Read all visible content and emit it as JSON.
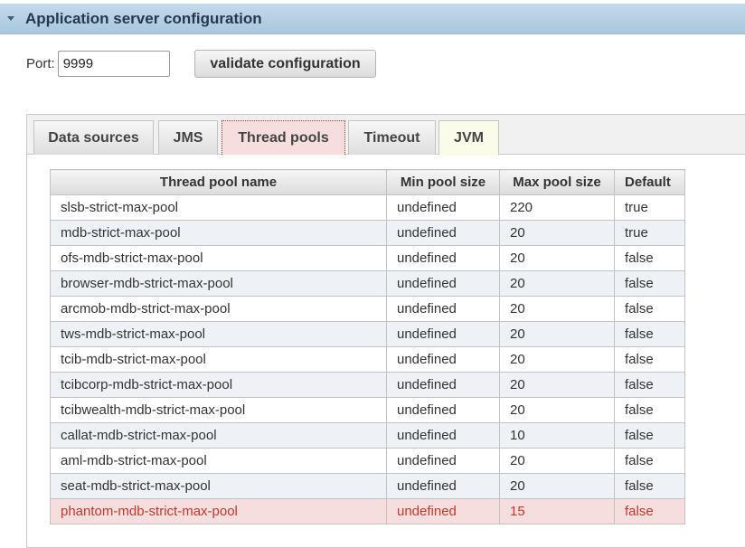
{
  "header": {
    "title": "Application server configuration"
  },
  "port": {
    "label": "Port:",
    "value": "9999"
  },
  "validate_button": "validate configuration",
  "tabs": [
    {
      "label": "Data sources"
    },
    {
      "label": "JMS"
    },
    {
      "label": "Thread pools"
    },
    {
      "label": "Timeout"
    },
    {
      "label": "JVM"
    }
  ],
  "table": {
    "columns": [
      "Thread pool name",
      "Min pool size",
      "Max pool size",
      "Default"
    ],
    "rows": [
      [
        "slsb-strict-max-pool",
        "undefined",
        "220",
        "true"
      ],
      [
        "mdb-strict-max-pool",
        "undefined",
        "20",
        "true"
      ],
      [
        "ofs-mdb-strict-max-pool",
        "undefined",
        "20",
        "false"
      ],
      [
        "browser-mdb-strict-max-pool",
        "undefined",
        "20",
        "false"
      ],
      [
        "arcmob-mdb-strict-max-pool",
        "undefined",
        "20",
        "false"
      ],
      [
        "tws-mdb-strict-max-pool",
        "undefined",
        "20",
        "false"
      ],
      [
        "tcib-mdb-strict-max-pool",
        "undefined",
        "20",
        "false"
      ],
      [
        "tcibcorp-mdb-strict-max-pool",
        "undefined",
        "20",
        "false"
      ],
      [
        "tcibwealth-mdb-strict-max-pool",
        "undefined",
        "20",
        "false"
      ],
      [
        "callat-mdb-strict-max-pool",
        "undefined",
        "10",
        "false"
      ],
      [
        "aml-mdb-strict-max-pool",
        "undefined",
        "20",
        "false"
      ],
      [
        "seat-mdb-strict-max-pool",
        "undefined",
        "20",
        "false"
      ],
      [
        "phantom-mdb-strict-max-pool",
        "undefined",
        "15",
        "false"
      ]
    ]
  },
  "colors": {
    "header_bg": "#b5d0e3",
    "highlight_bg": "#f6dede",
    "highlight_text": "#c0392b"
  }
}
